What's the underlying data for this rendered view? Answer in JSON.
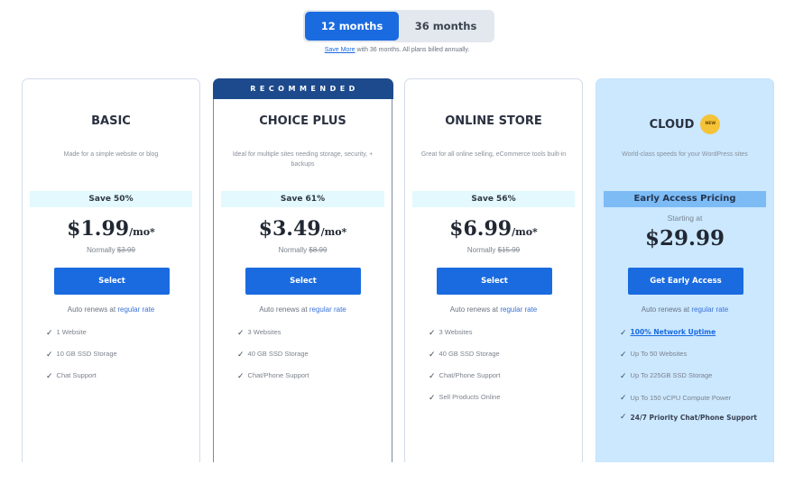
{
  "term_toggle": {
    "options": [
      "12 months",
      "36 months"
    ],
    "selected": "12 months",
    "note_link": "Save More",
    "note_text": " with 36 months. All plans billed annually."
  },
  "colors": {
    "primary_blue": "#1a6be0",
    "recommended_navy": "#1d4a8c",
    "cloud_bg": "#cbe8ff",
    "save_band": "#e3f9fe",
    "new_badge": "#f5c337"
  },
  "plans": [
    {
      "name": "BASIC",
      "description": "Made for a simple website or blog",
      "save": "Save 50%",
      "price": "$1.99",
      "unit": "/mo*",
      "normally_label": "Normally ",
      "normally_price": "$3.99",
      "button": "Select",
      "renews_text": "Auto renews at ",
      "renews_link": "regular rate",
      "features": [
        "1 Website",
        "10 GB SSD Storage",
        "Chat Support"
      ]
    },
    {
      "banner": "RECOMMENDED",
      "name": "CHOICE PLUS",
      "description": "Ideal for multiple sites needing storage, security, + backups",
      "save": "Save 61%",
      "price": "$3.49",
      "unit": "/mo*",
      "normally_label": "Normally ",
      "normally_price": "$8.99",
      "button": "Select",
      "renews_text": "Auto renews at ",
      "renews_link": "regular rate",
      "features": [
        "3 Websites",
        "40 GB SSD Storage",
        "Chat/Phone Support"
      ]
    },
    {
      "name": "ONLINE STORE",
      "description": "Great for all online selling, eCommerce tools built-in",
      "save": "Save 56%",
      "price": "$6.99",
      "unit": "/mo*",
      "normally_label": "Normally ",
      "normally_price": "$15.99",
      "button": "Select",
      "renews_text": "Auto renews at ",
      "renews_link": "regular rate",
      "features": [
        "3 Websites",
        "40 GB SSD Storage",
        "Chat/Phone Support",
        "Sell Products Online"
      ]
    },
    {
      "name": "CLOUD",
      "badge": "NEW",
      "description": "World-class speeds for your WordPress sites",
      "save": "Early Access Pricing",
      "starting_label": "Starting at",
      "price": "$29.99",
      "button": "Get Early Access",
      "renews_text": "Auto renews at ",
      "renews_link": "regular rate",
      "features": [
        "100% Network Uptime",
        "Up To 50 Websites",
        "Up To 225GB SSD Storage",
        "Up To 150 vCPU Compute Power",
        "24/7 Priority Chat/Phone Support"
      ]
    }
  ],
  "icons": {
    "feature_check": "checkmark-icon"
  }
}
